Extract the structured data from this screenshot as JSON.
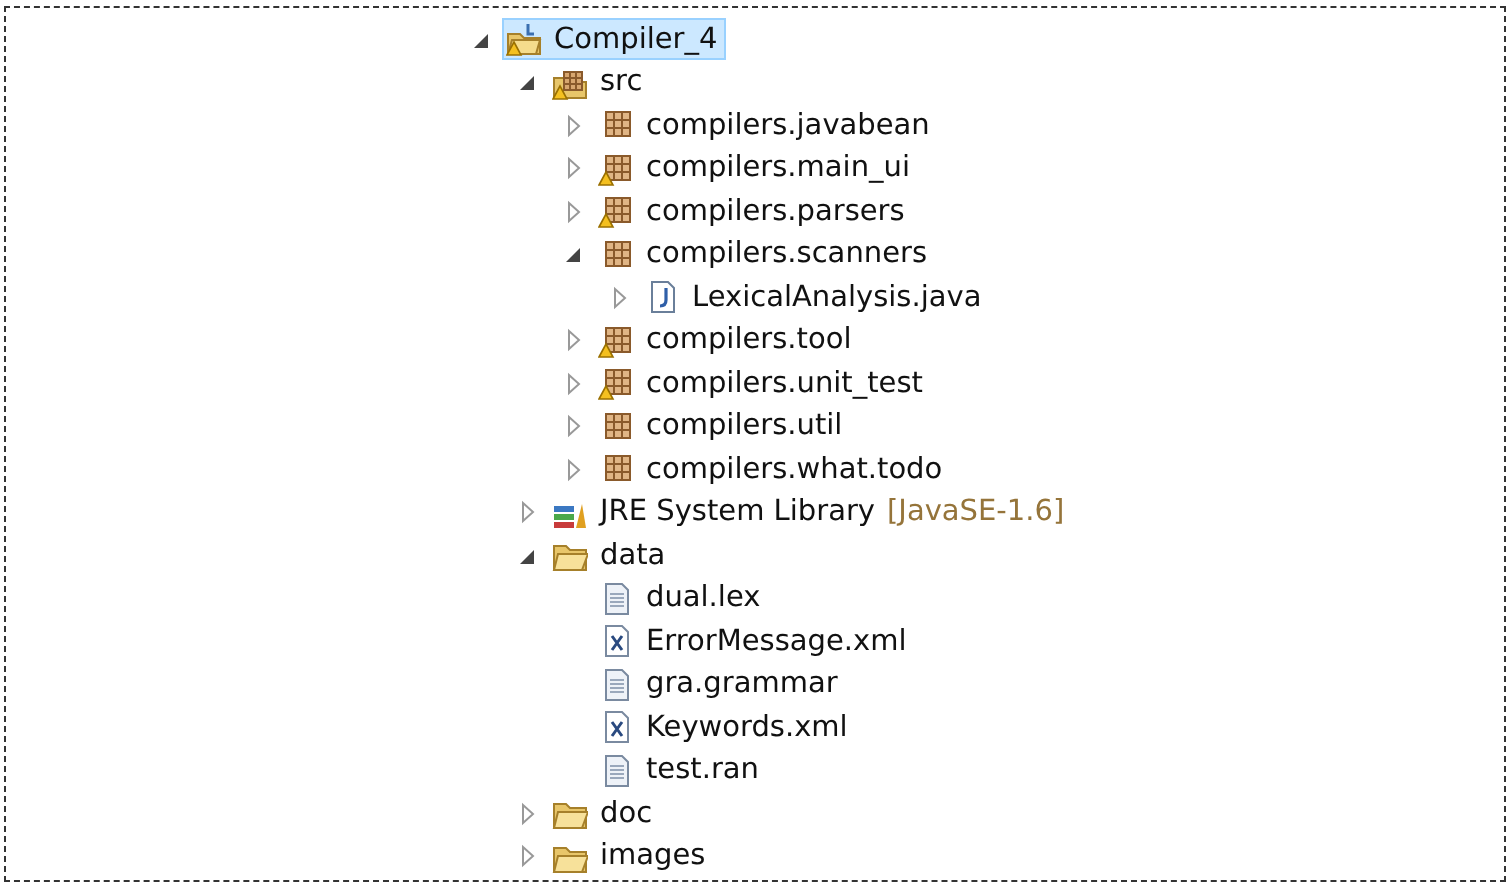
{
  "tree": [
    {
      "label": "Compiler_4",
      "kind": "project",
      "warning": true,
      "expanded": true,
      "selected": true,
      "children": [
        {
          "label": "src",
          "kind": "source-folder",
          "warning": true,
          "expanded": true,
          "selected": false,
          "children": [
            {
              "label": "compilers.javabean",
              "kind": "package",
              "warning": false,
              "expanded": false,
              "selected": false
            },
            {
              "label": "compilers.main_ui",
              "kind": "package",
              "warning": true,
              "expanded": false,
              "selected": false
            },
            {
              "label": "compilers.parsers",
              "kind": "package",
              "warning": true,
              "expanded": false,
              "selected": false
            },
            {
              "label": "compilers.scanners",
              "kind": "package",
              "warning": false,
              "expanded": true,
              "selected": false,
              "children": [
                {
                  "label": "LexicalAnalysis.java",
                  "kind": "java-file",
                  "warning": false,
                  "expanded": false,
                  "selected": false
                }
              ]
            },
            {
              "label": "compilers.tool",
              "kind": "package",
              "warning": true,
              "expanded": false,
              "selected": false
            },
            {
              "label": "compilers.unit_test",
              "kind": "package",
              "warning": true,
              "expanded": false,
              "selected": false
            },
            {
              "label": "compilers.util",
              "kind": "package",
              "warning": false,
              "expanded": false,
              "selected": false
            },
            {
              "label": "compilers.what.todo",
              "kind": "package",
              "warning": false,
              "expanded": false,
              "selected": false
            }
          ]
        },
        {
          "label": "JRE System Library",
          "decoration": "[JavaSE-1.6]",
          "kind": "library",
          "warning": false,
          "expanded": false,
          "selected": false
        },
        {
          "label": "data",
          "kind": "folder",
          "warning": false,
          "expanded": true,
          "selected": false,
          "children": [
            {
              "label": "dual.lex",
              "kind": "file",
              "warning": false,
              "selected": false
            },
            {
              "label": "ErrorMessage.xml",
              "kind": "xml-file",
              "warning": false,
              "selected": false
            },
            {
              "label": "gra.grammar",
              "kind": "file",
              "warning": false,
              "selected": false
            },
            {
              "label": "Keywords.xml",
              "kind": "xml-file",
              "warning": false,
              "selected": false
            },
            {
              "label": "test.ran",
              "kind": "file",
              "warning": false,
              "selected": false
            }
          ]
        },
        {
          "label": "doc",
          "kind": "folder",
          "warning": false,
          "expanded": false,
          "selected": false
        },
        {
          "label": "images",
          "kind": "folder",
          "warning": false,
          "expanded": false,
          "selected": false
        }
      ]
    }
  ]
}
